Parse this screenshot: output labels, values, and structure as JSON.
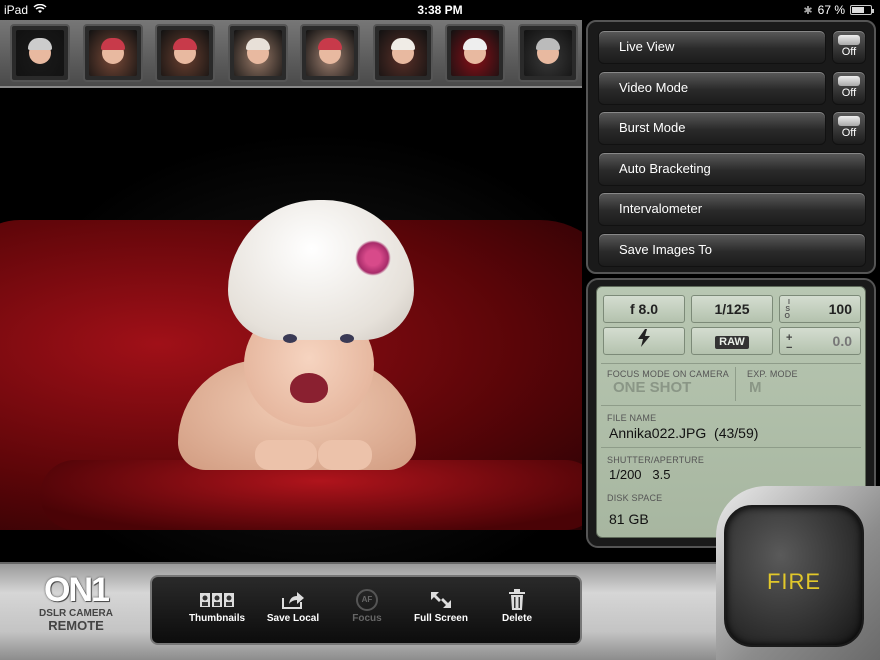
{
  "status_bar": {
    "device": "iPad",
    "time": "3:38 PM",
    "battery": "67 %",
    "battery_level": 0.67
  },
  "thumbnails": [
    {
      "name": "thumb-1",
      "bg": "#1a1a1a",
      "hat": "#cccccc"
    },
    {
      "name": "thumb-2",
      "bg": "#7a4a38",
      "hat": "#c83a4a"
    },
    {
      "name": "thumb-3",
      "bg": "#6a4030",
      "hat": "#c83a4a"
    },
    {
      "name": "thumb-4",
      "bg": "#9a7a68",
      "hat": "#e8e0d8"
    },
    {
      "name": "thumb-5",
      "bg": "#a08070",
      "hat": "#c83a4a"
    },
    {
      "name": "thumb-6",
      "bg": "#5a3028",
      "hat": "#f0ece6"
    },
    {
      "name": "thumb-7",
      "bg": "#8a1018",
      "hat": "#eeeeee"
    },
    {
      "name": "thumb-8",
      "bg": "#3a3a3a",
      "hat": "#bbbbbb"
    }
  ],
  "menu": {
    "live_view": "Live View",
    "video_mode": "Video Mode",
    "burst_mode": "Burst Mode",
    "auto_bracketing": "Auto Bracketing",
    "intervalometer": "Intervalometer",
    "save_images_to": "Save Images To",
    "toggle_off": "Off"
  },
  "lcd": {
    "aperture": "f 8.0",
    "shutter": "1/125",
    "iso_label": "I S O",
    "iso": "100",
    "flash_icon": "flash-icon",
    "quality": "RAW",
    "exp_comp_plus": "+",
    "exp_comp_minus": "−",
    "exp_comp": "0.0",
    "focus_mode_label": "FOCUS MODE ON CAMERA",
    "focus_mode": "ONE SHOT",
    "exp_mode_label": "EXP. MODE",
    "exp_mode": "M",
    "file_name_label": "FILE NAME",
    "file_name": "Annika022.JPG  (43/59)",
    "shutter_aperture_label": "SHUTTER/APERTURE",
    "shutter_aperture": "1/200   3.5",
    "disk_space_label": "DISK SPACE",
    "disk_space": "81 GB"
  },
  "toolbar": {
    "thumbnails": "Thumbnails",
    "save_local": "Save Local",
    "focus": "Focus",
    "focus_icon": "AF",
    "full_screen": "Full Screen",
    "delete": "Delete"
  },
  "logo": {
    "mark": "ON1",
    "line1": "DSLR CAMERA",
    "line2": "REMOTE"
  },
  "fire_label": "FIRE",
  "colors": {
    "fire_text": "#e2c82a",
    "lcd_bg": "#b0bfaa",
    "backdrop_red": "#a01018"
  }
}
